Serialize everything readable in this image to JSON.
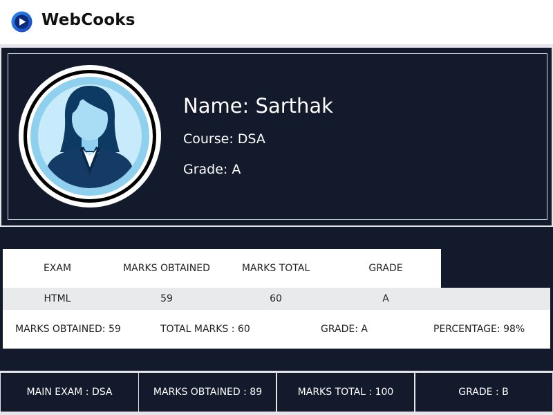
{
  "brand": {
    "name": "WebCooks",
    "logo_icon": "play-circle-icon",
    "logo_color": "#1b5ed6"
  },
  "profile": {
    "avatar_icon": "female-user-avatar-icon",
    "name": "Name: Sarthak",
    "course": "Course: DSA",
    "grade": "Grade: A"
  },
  "results": {
    "headers": [
      "EXAM",
      "MARKS OBTAINED",
      "MARKS TOTAL",
      "GRADE"
    ],
    "row": [
      "HTML",
      "59",
      "60",
      "A"
    ],
    "summary": {
      "marks_obtained": "MARKS OBTAINED: 59",
      "total_marks": "TOTAL MARKS : 60",
      "grade": "GRADE: A",
      "percentage": "PERCENTAGE: 98%"
    }
  },
  "main_exam": {
    "exam": "MAIN EXAM : DSA",
    "marks_obtained": "MARKS OBTAINED : 89",
    "marks_total": "MARKS TOTAL : 100",
    "grade": "GRADE : B"
  },
  "colors": {
    "navy": "#131a2c",
    "light_gray": "#e4e6ea",
    "row_gray": "#e9eaec"
  }
}
